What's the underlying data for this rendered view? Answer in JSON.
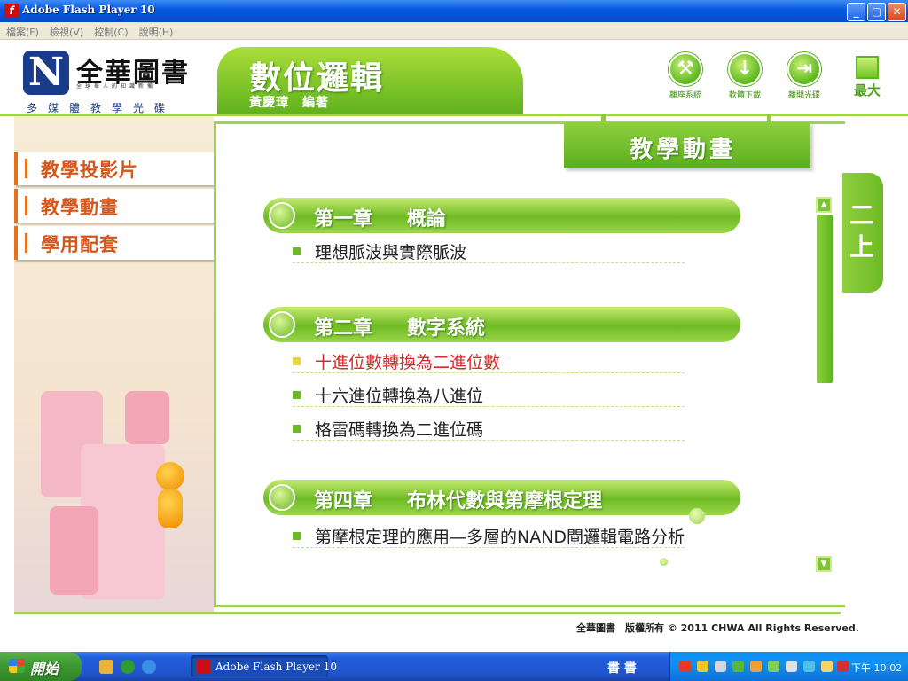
{
  "window": {
    "title": "Adobe Flash Player 10",
    "minimize": "_",
    "maximize": "▢",
    "close": "✕"
  },
  "menu": [
    "檔案(F)",
    "檢視(V)",
    "控制(C)",
    "說明(H)"
  ],
  "logo": {
    "mark": "N",
    "name": "全華圖書",
    "subline": "全球華人的知識新備",
    "tagline": "多媒體教學光碟"
  },
  "header": {
    "title": "數位邏輯",
    "author": "黃慶璋　編著"
  },
  "top_icons": [
    {
      "label": "離座系統",
      "icon": "tools-icon",
      "glyph": "⚒"
    },
    {
      "label": "軟體下載",
      "icon": "download-icon",
      "glyph": "↓"
    },
    {
      "label": "離開光碟",
      "icon": "exit-icon",
      "glyph": "⇥"
    }
  ],
  "maximize_label": "最大",
  "sidebar": {
    "items": [
      {
        "label": "教學投影片"
      },
      {
        "label": "教學動畫"
      },
      {
        "label": "學用配套"
      }
    ]
  },
  "section_title": "教學動畫",
  "volume_tab": {
    "line1": "二",
    "line2": "上"
  },
  "chapters": [
    {
      "num": "第一章",
      "name": "概論",
      "topics": [
        {
          "text": "理想脈波與實際脈波",
          "active": false
        }
      ]
    },
    {
      "num": "第二章",
      "name": "數字系統",
      "topics": [
        {
          "text": "十進位數轉換為二進位數",
          "active": true
        },
        {
          "text": "十六進位轉換為八進位",
          "active": false
        },
        {
          "text": "格雷碼轉換為二進位碼",
          "active": false
        }
      ]
    },
    {
      "num": "第四章",
      "name": "布林代數與第摩根定理",
      "topics": [
        {
          "text": "第摩根定理的應用—多層的NAND閘邏輯電路分析",
          "active": false
        }
      ]
    }
  ],
  "copyright": "全華圖書　版權所有 © 2011 CHWA All Rights Reserved.",
  "taskbar": {
    "start_label": "開始",
    "task_label": "Adobe Flash Player 10",
    "ime": "書 書",
    "clock": "下午 10:02"
  },
  "colors": {
    "accent_green": "#6fbb24",
    "nav_orange": "#e67118",
    "active_topic": "#d62a2a"
  }
}
